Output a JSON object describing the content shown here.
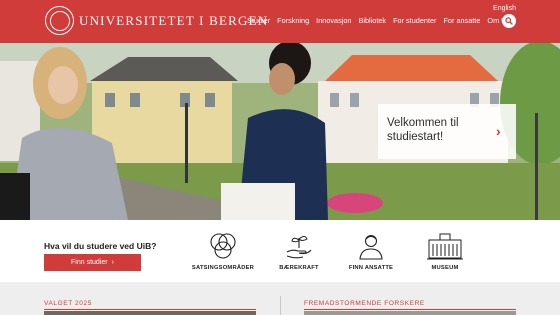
{
  "header": {
    "logo_text": "UNIVERSITETET I BERGEN",
    "language_link": "English",
    "nav": [
      {
        "label": "Studier"
      },
      {
        "label": "Forskning"
      },
      {
        "label": "Innovasjon"
      },
      {
        "label": "Bibliotek"
      },
      {
        "label": "For studenter"
      },
      {
        "label": "For ansatte"
      },
      {
        "label": "Om UiB"
      }
    ],
    "search_icon": "search-icon"
  },
  "hero": {
    "card_text": "Velkommen til studiestart!",
    "card_arrow": "›"
  },
  "study": {
    "title": "Hva vil du studere ved UiB?",
    "button_label": "Finn studier",
    "button_arrow": "›"
  },
  "quicklinks": [
    {
      "label": "SATSINGSOMRÅDER",
      "icon": "venn-circles-icon"
    },
    {
      "label": "BÆREKRAFT",
      "icon": "hand-plant-icon"
    },
    {
      "label": "FINN ANSATTE",
      "icon": "person-icon"
    },
    {
      "label": "MUSEUM",
      "icon": "museum-building-icon"
    }
  ],
  "sections": {
    "left_title": "VALGET 2025",
    "right_title": "FREMADSTORMENDE FORSKERE"
  },
  "colors": {
    "brand_red": "#cf3c3a",
    "white": "#ffffff",
    "page_gray": "#eeeeee"
  }
}
